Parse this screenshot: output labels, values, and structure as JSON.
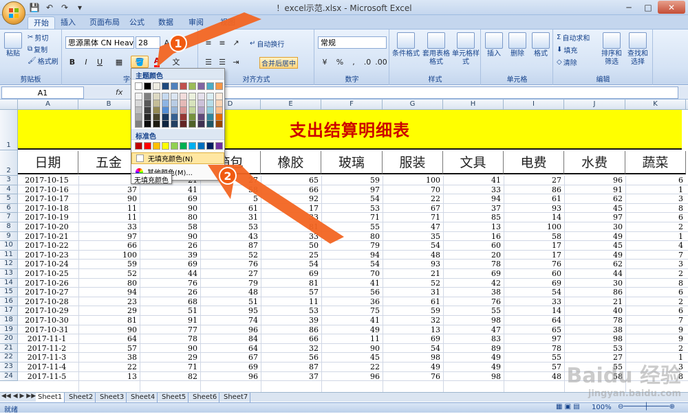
{
  "window": {
    "title": "！excel示范.xlsx - Microsoft Excel"
  },
  "tabs": [
    "开始",
    "插入",
    "页面布局",
    "公式",
    "数据",
    "审阅",
    "视图"
  ],
  "ribbon": {
    "clipboard": {
      "paste": "粘贴",
      "cut": "剪切",
      "copy": "复制",
      "format_painter": "格式刷",
      "label": "剪贴板"
    },
    "font": {
      "name": "思源黑体 CN Heavy",
      "size": "28",
      "bold": "B",
      "italic": "I",
      "underline": "U",
      "label": "字体"
    },
    "alignment": {
      "wrap": "自动换行",
      "merge": "合并后居中",
      "label": "对齐方式"
    },
    "number": {
      "format": "常规",
      "percent": "%",
      "comma": ",",
      "label": "数字"
    },
    "styles": {
      "conditional": "条件格式",
      "table": "套用表格格式",
      "cell": "单元格样式",
      "label": "样式"
    },
    "cells": {
      "insert": "插入",
      "delete": "删除",
      "format": "格式",
      "label": "单元格"
    },
    "editing": {
      "autosum": "自动求和",
      "fill": "填充",
      "clear": "清除",
      "sort": "排序和筛选",
      "find": "查找和选择",
      "label": "编辑"
    }
  },
  "formula_bar": {
    "name_box": "A1",
    "fx": "fx"
  },
  "sheet": {
    "columns": [
      "A",
      "B",
      "C",
      "D",
      "E",
      "F",
      "G",
      "H",
      "I",
      "J",
      "K"
    ],
    "title": "支出结算明细表",
    "headers": [
      "日期",
      "五金",
      "",
      "箱包",
      "橡胶",
      "玻璃",
      "服装",
      "文具",
      "电费",
      "水费",
      "蔬菜"
    ],
    "rows": [
      [
        "3",
        "2017-10-15",
        "",
        "21",
        "27",
        "65",
        "59",
        "100",
        "41",
        "27",
        "96",
        "6"
      ],
      [
        "4",
        "2017-10-16",
        "37",
        "41",
        "58",
        "66",
        "97",
        "70",
        "33",
        "86",
        "91",
        "1"
      ],
      [
        "5",
        "2017-10-17",
        "90",
        "69",
        "5",
        "92",
        "54",
        "22",
        "94",
        "61",
        "62",
        "3"
      ],
      [
        "6",
        "2017-10-18",
        "11",
        "90",
        "61",
        "17",
        "53",
        "67",
        "37",
        "93",
        "45",
        "8"
      ],
      [
        "7",
        "2017-10-19",
        "11",
        "80",
        "31",
        "33",
        "71",
        "71",
        "85",
        "14",
        "97",
        "6"
      ],
      [
        "8",
        "2017-10-20",
        "33",
        "58",
        "53",
        "81",
        "55",
        "47",
        "13",
        "100",
        "30",
        "2"
      ],
      [
        "9",
        "2017-10-21",
        "97",
        "90",
        "43",
        "33",
        "80",
        "35",
        "16",
        "58",
        "49",
        "1"
      ],
      [
        "10",
        "2017-10-22",
        "66",
        "26",
        "87",
        "50",
        "79",
        "54",
        "60",
        "17",
        "45",
        "4"
      ],
      [
        "11",
        "2017-10-23",
        "100",
        "39",
        "52",
        "25",
        "94",
        "48",
        "20",
        "17",
        "49",
        "7"
      ],
      [
        "12",
        "2017-10-24",
        "59",
        "69",
        "76",
        "54",
        "54",
        "93",
        "78",
        "76",
        "62",
        "3"
      ],
      [
        "13",
        "2017-10-25",
        "52",
        "44",
        "27",
        "69",
        "70",
        "21",
        "69",
        "60",
        "44",
        "2"
      ],
      [
        "14",
        "2017-10-26",
        "80",
        "76",
        "79",
        "81",
        "41",
        "52",
        "42",
        "69",
        "30",
        "8"
      ],
      [
        "15",
        "2017-10-27",
        "94",
        "26",
        "48",
        "57",
        "56",
        "31",
        "38",
        "54",
        "86",
        "6"
      ],
      [
        "16",
        "2017-10-28",
        "23",
        "68",
        "51",
        "11",
        "36",
        "61",
        "76",
        "33",
        "21",
        "2"
      ],
      [
        "17",
        "2017-10-29",
        "29",
        "51",
        "95",
        "53",
        "75",
        "59",
        "55",
        "14",
        "40",
        "6"
      ],
      [
        "18",
        "2017-10-30",
        "81",
        "91",
        "74",
        "39",
        "41",
        "32",
        "98",
        "64",
        "78",
        "7"
      ],
      [
        "19",
        "2017-10-31",
        "90",
        "77",
        "96",
        "86",
        "49",
        "13",
        "47",
        "65",
        "38",
        "9"
      ],
      [
        "20",
        "2017-11-1",
        "64",
        "78",
        "84",
        "66",
        "11",
        "69",
        "83",
        "97",
        "98",
        "9"
      ],
      [
        "21",
        "2017-11-2",
        "57",
        "90",
        "64",
        "32",
        "90",
        "54",
        "89",
        "78",
        "53",
        "2"
      ],
      [
        "22",
        "2017-11-3",
        "38",
        "29",
        "67",
        "56",
        "45",
        "98",
        "49",
        "55",
        "27",
        "1"
      ],
      [
        "23",
        "2017-11-4",
        "22",
        "71",
        "69",
        "87",
        "22",
        "49",
        "49",
        "57",
        "55",
        "3"
      ],
      [
        "24",
        "2017-11-5",
        "13",
        "82",
        "96",
        "37",
        "96",
        "76",
        "98",
        "48",
        "58",
        "8"
      ]
    ]
  },
  "color_menu": {
    "theme_label": "主题颜色",
    "standard_label": "标准色",
    "no_fill": "无填充颜色(N)",
    "more_colors": "其他颜色(M)...",
    "tooltip": "无填充颜色",
    "theme_top": [
      "#ffffff",
      "#000000",
      "#eeece1",
      "#1f497d",
      "#4f81bd",
      "#c0504d",
      "#9bbb59",
      "#8064a2",
      "#4bacc6",
      "#f79646"
    ],
    "theme_shades": [
      [
        "#f2f2f2",
        "#7f7f7f",
        "#ddd9c3",
        "#c6d9f0",
        "#dbe5f1",
        "#f2dcdb",
        "#ebf1dd",
        "#e5e0ec",
        "#dbeef3",
        "#fdeada"
      ],
      [
        "#d8d8d8",
        "#595959",
        "#c4bd97",
        "#8db3e2",
        "#b8cce4",
        "#e5b9b7",
        "#d7e3bc",
        "#ccc1d9",
        "#b7dde8",
        "#fbd5b5"
      ],
      [
        "#bfbfbf",
        "#3f3f3f",
        "#938953",
        "#548dd4",
        "#95b3d7",
        "#d99694",
        "#c3d69b",
        "#b2a2c7",
        "#92cddc",
        "#fac08f"
      ],
      [
        "#a5a5a5",
        "#262626",
        "#494429",
        "#17365d",
        "#366092",
        "#953734",
        "#76923c",
        "#5f497a",
        "#31859b",
        "#e36c09"
      ],
      [
        "#7f7f7f",
        "#0c0c0c",
        "#1d1b10",
        "#0f243e",
        "#244061",
        "#632423",
        "#4f6128",
        "#3f3151",
        "#205867",
        "#974806"
      ]
    ],
    "standard": [
      "#c00000",
      "#ff0000",
      "#ffc000",
      "#ffff00",
      "#92d050",
      "#00b050",
      "#00b0f0",
      "#0070c0",
      "#002060",
      "#7030a0"
    ]
  },
  "sheet_tabs": [
    "Sheet1",
    "Sheet2",
    "Sheet3",
    "Sheet4",
    "Sheet5",
    "Sheet6",
    "Sheet7"
  ],
  "status": {
    "ready": "就绪",
    "zoom": "100%"
  },
  "annotations": {
    "badge1": "1",
    "badge2": "2"
  },
  "watermark": {
    "brand": "Baidu 经验",
    "url": "jingyan.baidu.com"
  }
}
